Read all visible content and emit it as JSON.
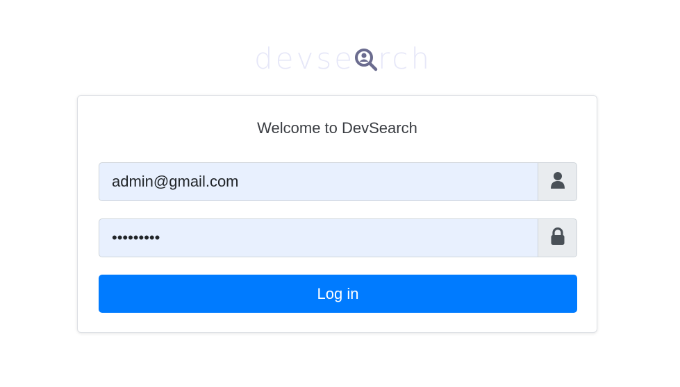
{
  "logo": {
    "text_before": "devse",
    "text_after": "rch",
    "icon": "magnifier-user-icon"
  },
  "login_card": {
    "welcome": "Welcome to DevSearch",
    "email": {
      "value": "admin@gmail.com",
      "icon": "user-icon"
    },
    "password": {
      "value": "•••••••••",
      "icon": "lock-icon"
    },
    "submit_label": "Log in"
  },
  "colors": {
    "primary": "#007bff",
    "input_bg": "#e8f0fe",
    "addon_bg": "#e9ecef",
    "logo_light": "#e6e7f8",
    "logo_icon": "#6b6c8f"
  }
}
